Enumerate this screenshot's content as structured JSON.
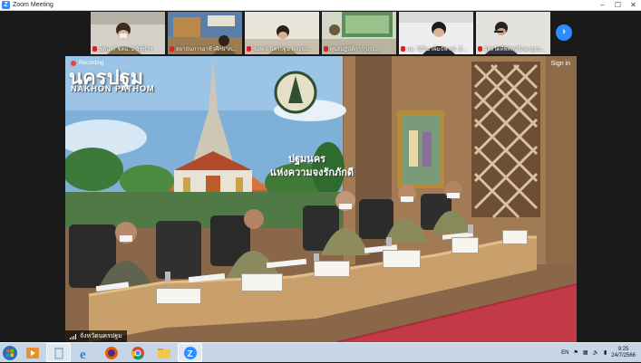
{
  "window": {
    "title": "Zoom Meeting",
    "controls": [
      "minimize-icon",
      "maximize-icon",
      "close-icon"
    ]
  },
  "gallery": {
    "participants": [
      {
        "name": "ชคน. 7 ชคม. 2 วิชุฬาฯ",
        "muted": true
      },
      {
        "name": "สถาบันการอาชีวศึกษาภ...",
        "muted": true
      },
      {
        "name": "ชลพ 3 นครปฐม เบญจม...",
        "muted": true
      },
      {
        "name": "ศูนย์ปฏิบัติการ(ประ...",
        "muted": true
      },
      {
        "name": "ผอ. วิธีวิน เพ็มบัฟ ศฝ. สี...",
        "muted": true
      },
      {
        "name": "จังหวัดที่พิทักษ์รักษาธุรบ...",
        "muted": true
      }
    ],
    "next_page_icon": "chevron-right-icon"
  },
  "speaker": {
    "recording_label": "Recording",
    "sign_in_label": "Sign in",
    "name": "จังหวัดนครปฐม",
    "backdrop": {
      "title_thai": "นครปฐม",
      "title_en": "NAKHON PATHOM",
      "slogan_line1": "ปฐมนคร",
      "slogan_line2": "แห่งความจงรักภักดี"
    }
  },
  "taskbar": {
    "start_icon": "windows-start-icon",
    "apps": [
      {
        "name": "media-player-icon",
        "active": false
      },
      {
        "name": "recycle-bin-icon",
        "active": true
      },
      {
        "name": "internet-explorer-icon",
        "active": false
      },
      {
        "name": "firefox-icon",
        "active": false
      },
      {
        "name": "chrome-icon",
        "active": false
      },
      {
        "name": "file-explorer-icon",
        "active": false
      },
      {
        "name": "zoom-icon",
        "active": true
      }
    ],
    "tray": {
      "language": "EN",
      "time": "9:25",
      "date": "24/7/2566"
    }
  },
  "colors": {
    "zoom_blue": "#2d8cff",
    "recording_red": "#e84040",
    "taskbar": "#c6d6e6"
  }
}
